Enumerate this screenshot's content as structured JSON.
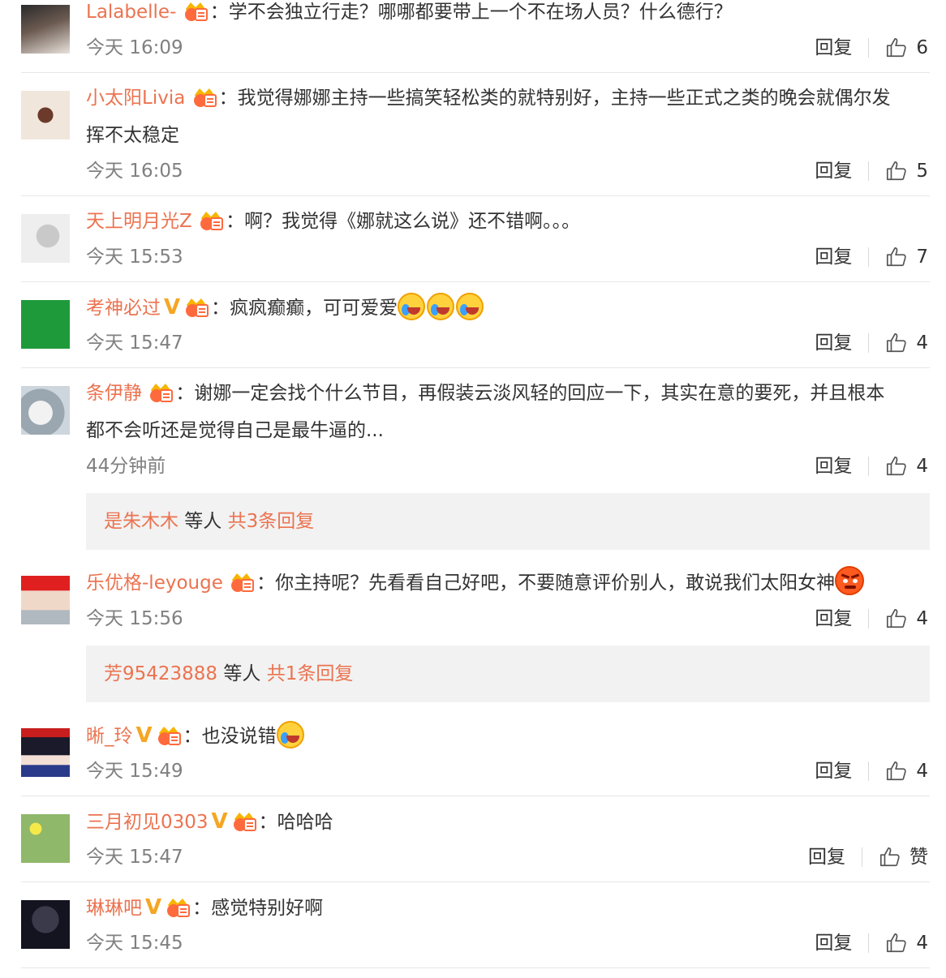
{
  "comments": [
    {
      "user": "Lalabelle-",
      "vip": false,
      "text": "学不会独立行走？哪哪都要带上一个不在场人员？什么德行？",
      "time": "今天 16:09",
      "reply": "回复",
      "likes": "6",
      "emojis": 0
    },
    {
      "user": "小太阳Livia",
      "vip": false,
      "text": "我觉得娜娜主持一些搞笑轻松类的就特别好，主持一些正式之类的晚会就偶尔发",
      "text2": "挥不太稳定",
      "time": "今天 16:05",
      "reply": "回复",
      "likes": "5"
    },
    {
      "user": "天上明月光Z",
      "vip": false,
      "text": "啊？我觉得《娜就这么说》还不错啊。。。",
      "time": "今天 15:53",
      "reply": "回复",
      "likes": "7"
    },
    {
      "user": "考神必过",
      "vip": true,
      "text": "疯疯癫癫，可可爱爱",
      "time": "今天 15:47",
      "reply": "回复",
      "likes": "4"
    },
    {
      "user": "条伊静",
      "vip": false,
      "text": "谢娜一定会找个什么节目，再假装云淡风轻的回应一下，其实在意的要死，并且根本",
      "text2": "都不会听还是觉得自己是最牛逼的...",
      "time": "44分钟前",
      "reply": "回复",
      "likes": "4",
      "more": {
        "who": "是朱木木",
        "mid": " 等人 ",
        "count": "共3条回复"
      }
    },
    {
      "user": "乐优格-leyouge",
      "vip": false,
      "text": "你主持呢？先看看自己好吧，不要随意评价别人，敢说我们太阳女神",
      "time": "今天 15:56",
      "reply": "回复",
      "likes": "4",
      "more": {
        "who": "芳95423888",
        "mid": " 等人 ",
        "count": "共1条回复"
      }
    },
    {
      "user": "晰_玲",
      "vip": true,
      "text": "也没说错",
      "time": "今天 15:49",
      "reply": "回复",
      "likes": "4"
    },
    {
      "user": "三月初见0303",
      "vip": true,
      "text": "哈哈哈",
      "time": "今天 15:47",
      "reply": "回复",
      "likes": "赞"
    },
    {
      "user": "琳琳吧",
      "vip": true,
      "text": "感觉特别好啊",
      "time": "今天 15:45",
      "reply": "回复",
      "likes": "4"
    }
  ],
  "colon": "："
}
